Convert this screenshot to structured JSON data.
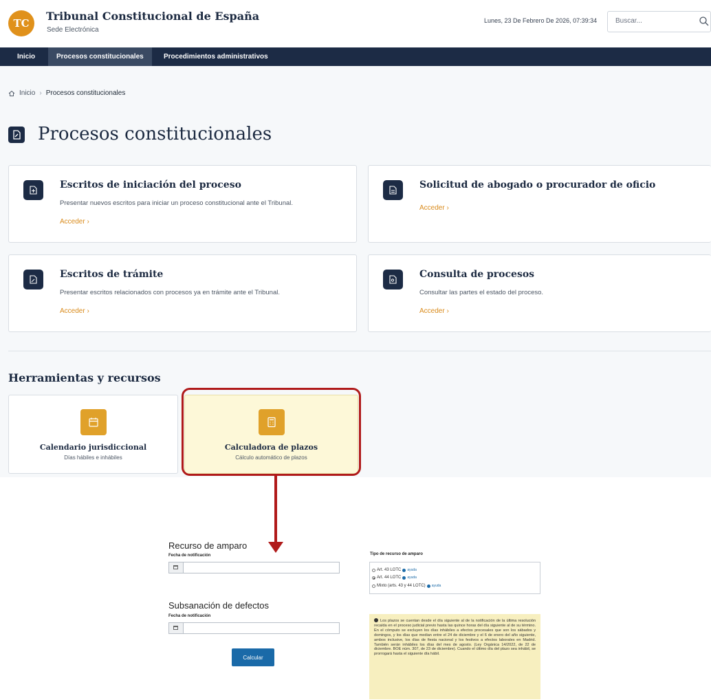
{
  "header": {
    "logo_text": "TC",
    "title": "Tribunal Constitucional de España",
    "subtitle": "Sede Electrónica",
    "datetime": "Lunes, 23 De Febrero De 2026, 07:39:34",
    "search_placeholder": "Buscar..."
  },
  "nav": {
    "items": [
      {
        "label": "Inicio"
      },
      {
        "label": "Procesos constitucionales"
      },
      {
        "label": "Procedimientos administrativos"
      }
    ],
    "active": "Procesos constitucionales"
  },
  "breadcrumb": {
    "home": "Inicio",
    "current": "Procesos constitucionales"
  },
  "page_title": "Procesos constitucionales",
  "cards": [
    {
      "title": "Escritos de iniciación del proceso",
      "desc": "Presentar nuevos escritos para iniciar un proceso constitucional ante el Tribunal.",
      "link": "Acceder  ›",
      "icon": "file-plus-icon"
    },
    {
      "title": "Solicitud de abogado o procurador de oficio",
      "desc": "",
      "link": "Acceder  ›",
      "icon": "document-icon"
    },
    {
      "title": "Escritos de trámite",
      "desc": "Presentar escritos relacionados con procesos ya en trámite ante el Tribunal.",
      "link": "Acceder  ›",
      "icon": "file-edit-icon"
    },
    {
      "title": "Consulta de procesos",
      "desc": "Consultar las partes el estado del proceso.",
      "link": "Acceder  ›",
      "icon": "file-search-icon"
    }
  ],
  "tools_title": "Herramientas y recursos",
  "tools": [
    {
      "title": "Calendario jurisdiccional",
      "sub": "Días hábiles e inhábiles",
      "icon": "calendar-icon"
    },
    {
      "title": "Calculadora de plazos",
      "sub": "Cálculo automático de plazos",
      "icon": "calculator-icon"
    }
  ],
  "calculator": {
    "amparo_title": "Recurso de amparo",
    "amparo_label": "Fecha de notificación",
    "subsanacion_title": "Subsanación de defectos",
    "subsanacion_label": "Fecha de notificación",
    "button": "Calcular",
    "tipo_label": "Tipo de recurso de amparo",
    "options": [
      {
        "label": "Art. 43 LOTC",
        "help": "ayuda",
        "checked": false
      },
      {
        "label": "Art. 44 LOTC",
        "help": "ayuda",
        "checked": true
      },
      {
        "label": "Mixto (arts. 43 y 44 LOTC)",
        "help": "ayuda",
        "checked": false
      }
    ],
    "note": "Los plazos se cuentan desde el día siguiente al de la notificación de la última resolución recaída en el proceso judicial previo hasta las quince horas del día siguiente al de su término. En el cómputo se excluyen los días inhábiles a efectos procesales que son los sábados y domingos, y los días que median entre el 24 de diciembre y el 6 de enero del año siguiente, ambos inclusive, los días de fiesta nacional y los festivos a efectos laborales en Madrid. También serán inhábiles los días del mes de agosto. (Ley Orgánica 14/2022, de 22 de diciembre. BOE núm. 307, de 23 de diciembre). Cuando el último día del plazo sea inhábil, se prorrogará hasta el siguiente día hábil."
  },
  "colors": {
    "navy": "#1c2b45",
    "accent": "#e0911b",
    "link": "#d98a1a",
    "highlight": "#b01a1a",
    "tool_bg": "#fdf8d8"
  }
}
